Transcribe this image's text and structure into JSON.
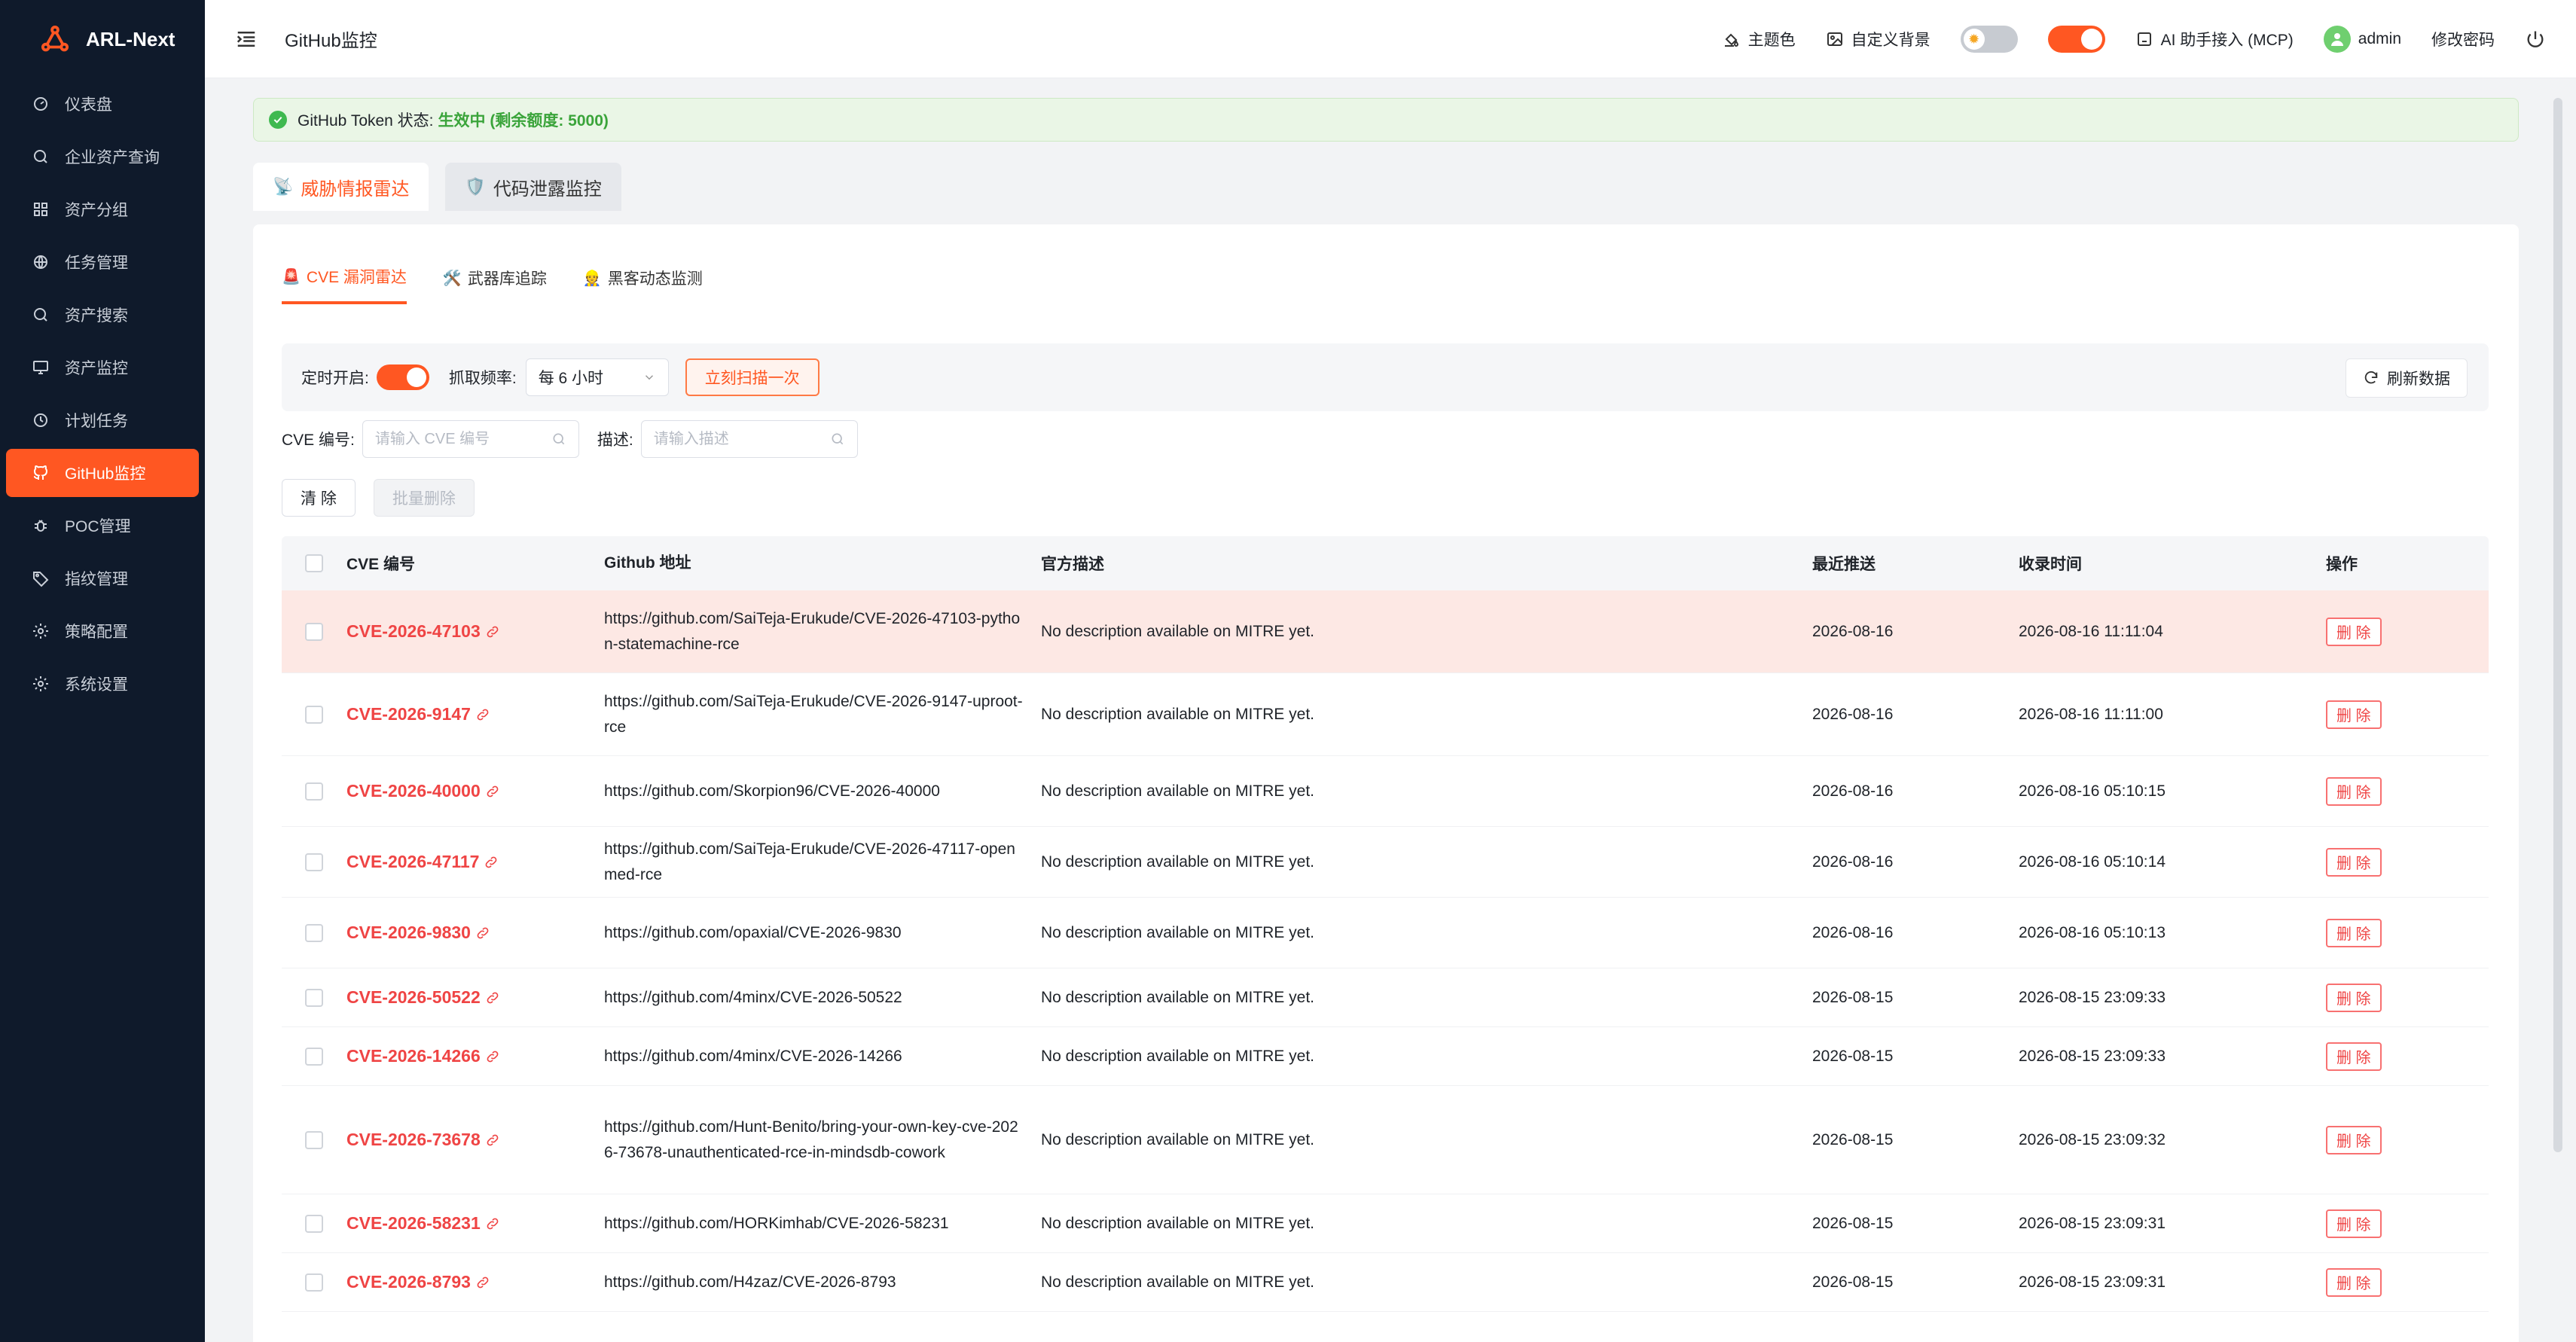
{
  "app": {
    "name": "ARL-Next"
  },
  "sidebar": {
    "items": [
      {
        "label": "仪表盘",
        "icon": "dashboard-icon"
      },
      {
        "label": "企业资产查询",
        "icon": "search-icon"
      },
      {
        "label": "资产分组",
        "icon": "grid-icon"
      },
      {
        "label": "任务管理",
        "icon": "globe-icon"
      },
      {
        "label": "资产搜索",
        "icon": "search-icon"
      },
      {
        "label": "资产监控",
        "icon": "monitor-icon"
      },
      {
        "label": "计划任务",
        "icon": "clock-icon"
      },
      {
        "label": "GitHub监控",
        "icon": "github-icon",
        "active": true
      },
      {
        "label": "POC管理",
        "icon": "bug-icon"
      },
      {
        "label": "指纹管理",
        "icon": "tag-icon"
      },
      {
        "label": "策略配置",
        "icon": "settings-icon"
      },
      {
        "label": "系统设置",
        "icon": "gear-icon"
      }
    ]
  },
  "header": {
    "title": "GitHub监控",
    "theme": "主题色",
    "background": "自定义背景",
    "ai": "AI 助手接入 (MCP)",
    "user": "admin",
    "change_password": "修改密码"
  },
  "banner": {
    "prefix": "GitHub Token 状态:",
    "status": "生效中 (剩余额度: 5000)"
  },
  "top_tabs": [
    {
      "icon": "📡",
      "label": "威胁情报雷达",
      "active": true
    },
    {
      "icon": "🛡️",
      "label": "代码泄露监控"
    }
  ],
  "sub_tabs": [
    {
      "icon": "🚨",
      "label": "CVE 漏洞雷达",
      "active": true
    },
    {
      "icon": "🛠️",
      "label": "武器库追踪"
    },
    {
      "icon": "👷",
      "label": "黑客动态监测"
    }
  ],
  "toolbar": {
    "timer_label": "定时开启:",
    "freq_label": "抓取频率:",
    "freq_value": "每 6 小时",
    "scan_button": "立刻扫描一次",
    "refresh_button": "刷新数据"
  },
  "filters": {
    "cve_label": "CVE 编号:",
    "cve_placeholder": "请输入 CVE 编号",
    "desc_label": "描述:",
    "desc_placeholder": "请输入描述"
  },
  "actions": {
    "clear": "清 除",
    "batch_delete": "批量删除"
  },
  "table": {
    "columns": [
      "CVE 编号",
      "Github 地址",
      "官方描述",
      "最近推送",
      "收录时间",
      "操作"
    ],
    "delete_label": "删 除",
    "rows": [
      {
        "cve": "CVE-2026-47103",
        "url": "https://github.com/SaiTeja-Erukude/CVE-2026-47103-python-statemachine-rce",
        "desc": "No description available on MITRE yet.",
        "push": "2026-08-16",
        "time": "2026-08-16 11:11:04",
        "highlight": true
      },
      {
        "cve": "CVE-2026-9147",
        "url": "https://github.com/SaiTeja-Erukude/CVE-2026-9147-uproot-rce",
        "desc": "No description available on MITRE yet.",
        "push": "2026-08-16",
        "time": "2026-08-16 11:11:00"
      },
      {
        "cve": "CVE-2026-40000",
        "url": "https://github.com/Skorpion96/CVE-2026-40000",
        "desc": "No description available on MITRE yet.",
        "push": "2026-08-16",
        "time": "2026-08-16 05:10:15"
      },
      {
        "cve": "CVE-2026-47117",
        "url": "https://github.com/SaiTeja-Erukude/CVE-2026-47117-openmed-rce",
        "desc": "No description available on MITRE yet.",
        "push": "2026-08-16",
        "time": "2026-08-16 05:10:14"
      },
      {
        "cve": "CVE-2026-9830",
        "url": "https://github.com/opaxial/CVE-2026-9830",
        "desc": "No description available on MITRE yet.",
        "push": "2026-08-16",
        "time": "2026-08-16 05:10:13"
      },
      {
        "cve": "CVE-2026-50522",
        "url": "https://github.com/4minx/CVE-2026-50522",
        "desc": "No description available on MITRE yet.",
        "push": "2026-08-15",
        "time": "2026-08-15 23:09:33"
      },
      {
        "cve": "CVE-2026-14266",
        "url": "https://github.com/4minx/CVE-2026-14266",
        "desc": "No description available on MITRE yet.",
        "push": "2026-08-15",
        "time": "2026-08-15 23:09:33"
      },
      {
        "cve": "CVE-2026-73678",
        "url": "https://github.com/Hunt-Benito/bring-your-own-key-cve-2026-73678-unauthenticated-rce-in-mindsdb-cowork",
        "desc": "No description available on MITRE yet.",
        "push": "2026-08-15",
        "time": "2026-08-15 23:09:32"
      },
      {
        "cve": "CVE-2026-58231",
        "url": "https://github.com/HORKimhab/CVE-2026-58231",
        "desc": "No description available on MITRE yet.",
        "push": "2026-08-15",
        "time": "2026-08-15 23:09:31"
      },
      {
        "cve": "CVE-2026-8793",
        "url": "https://github.com/H4zaz/CVE-2026-8793",
        "desc": "No description available on MITRE yet.",
        "push": "2026-08-15",
        "time": "2026-08-15 23:09:31"
      }
    ]
  },
  "colors": {
    "accent": "#ff5722",
    "sidebar": "#0f1a2b",
    "danger": "#ef4444"
  }
}
